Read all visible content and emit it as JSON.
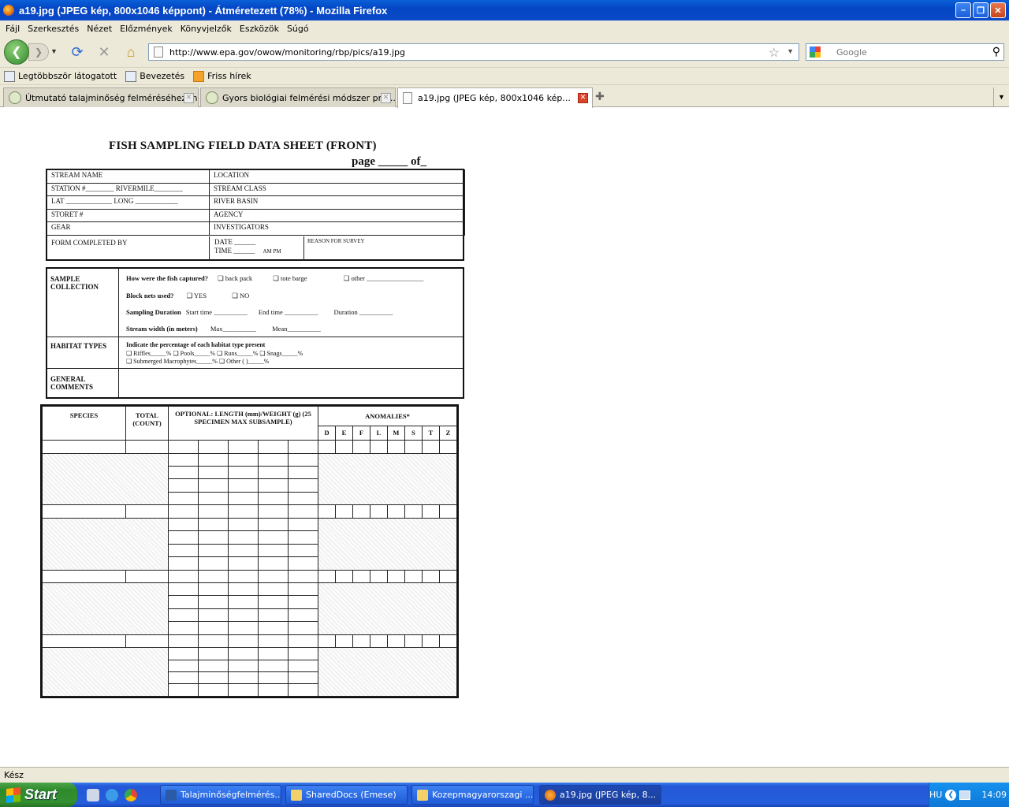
{
  "window": {
    "title": "a19.jpg (JPEG kép, 800x1046 képpont) - Átméretezett (78%) - Mozilla Firefox"
  },
  "menu": [
    "Fájl",
    "Szerkesztés",
    "Nézet",
    "Előzmények",
    "Könyvjelzők",
    "Eszközök",
    "Súgó"
  ],
  "nav": {
    "url": "http://www.epa.gov/owow/monitoring/rbp/pics/a19.jpg",
    "search_placeholder": "Google"
  },
  "bookmarks": [
    "Legtöbbször látogatott",
    "Bevezetés",
    "Friss hírek"
  ],
  "tabs": [
    {
      "label": "Útmutató talajminőség felméréséhez m..."
    },
    {
      "label": "Gyors biológiai felmérési módszer prot..."
    },
    {
      "label": "a19.jpg (JPEG kép, 800x1046 kép..."
    }
  ],
  "status": "Kész",
  "taskbar": {
    "start": "Start",
    "tasks": [
      "Talajminőségfelmérés...",
      "SharedDocs (Emese)",
      "Kozepmagyarorszagi ...",
      "a19.jpg (JPEG kép, 8..."
    ],
    "lang": "HU",
    "clock": "14:09"
  },
  "doc": {
    "title": "FISH SAMPLING FIELD DATA SHEET (FRONT)",
    "page": "page _____ of_",
    "header_left": [
      "STREAM NAME",
      "STATION #________ RIVERMILE________",
      "LAT _____________ LONG ____________",
      "STORET #",
      "GEAR",
      "FORM COMPLETED BY"
    ],
    "header_right": [
      "LOCATION",
      "STREAM CLASS",
      "RIVER BASIN",
      "AGENCY",
      "INVESTIGATORS"
    ],
    "date_time": {
      "date": "DATE ______",
      "time": "TIME ______",
      "ampm": "AM   PM",
      "reason": "REASON FOR SURVEY"
    },
    "sample_collection": {
      "label": "SAMPLE COLLECTION",
      "q1": "How were the fish captured?",
      "opts1": [
        "❑ back pack",
        "❑ tote barge",
        "❑ other _________________"
      ],
      "q2": "Block nets used?",
      "opts2": [
        "❑ YES",
        "❑ NO"
      ],
      "q3": "Sampling Duration",
      "opts3": [
        "Start time __________",
        "End time __________",
        "Duration __________"
      ],
      "q4": "Stream width (in meters)",
      "opts4": [
        "Max__________",
        "Mean__________"
      ]
    },
    "habitat": {
      "label": "HABITAT TYPES",
      "line0": "Indicate the percentage of each habitat type present",
      "line1": "❑ Riffles_____%    ❑ Pools_____%    ❑ Runs_____%    ❑ Snags_____%",
      "line2": "❑ Submerged Macrophytes_____%    ❑ Other (                    )_____%"
    },
    "comments": {
      "label": "GENERAL COMMENTS"
    },
    "grid": {
      "species": "SPECIES",
      "total": "TOTAL (COUNT)",
      "optional": "OPTIONAL: LENGTH (mm)/WEIGHT (g) (25 SPECIMEN MAX SUBSAMPLE)",
      "anomalies": "ANOMALIES*",
      "codes": [
        "D",
        "E",
        "F",
        "L",
        "M",
        "S",
        "T",
        "Z"
      ]
    }
  }
}
